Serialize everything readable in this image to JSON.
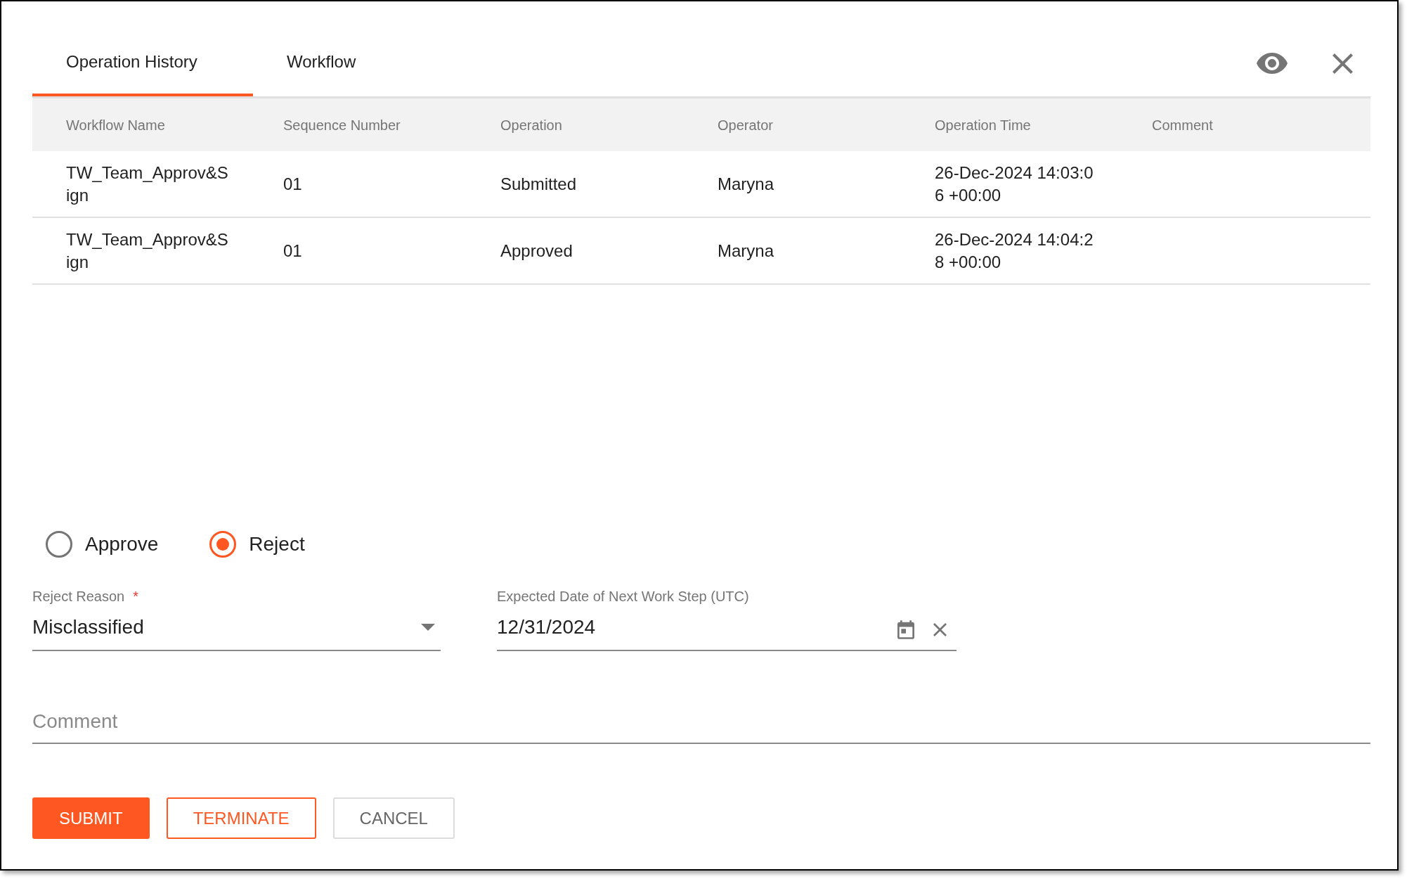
{
  "tabs": [
    {
      "label": "Operation History",
      "selected": true
    },
    {
      "label": "Workflow",
      "selected": false
    }
  ],
  "table": {
    "columns": [
      "Workflow Name",
      "Sequence Number",
      "Operation",
      "Operator",
      "Operation Time",
      "Comment"
    ],
    "rows": [
      {
        "cells": [
          "TW_Team_Approv&Sign",
          "01",
          "Submitted",
          "Maryna",
          "26-Dec-2024 14:03:06 +00:00"
        ]
      },
      {
        "cells": [
          "TW_Team_Approv&Sign",
          "01",
          "Approved",
          "Maryna",
          "26-Dec-2024 14:04:28 +00:00"
        ]
      }
    ]
  },
  "decision": {
    "options": [
      {
        "label": "Approve",
        "selected": false
      },
      {
        "label": "Reject",
        "selected": true
      }
    ]
  },
  "reject_reason": {
    "label": "Reject Reason",
    "required_mark": "*",
    "value": "Misclassified"
  },
  "expected_date": {
    "label": "Expected Date of Next Work Step (UTC)",
    "value": "12/31/2024"
  },
  "comment": {
    "placeholder": "Comment"
  },
  "buttons": [
    {
      "label": "SUBMIT",
      "kind": "primary"
    },
    {
      "label": "TERMINATE",
      "kind": "outline"
    },
    {
      "label": "CANCEL",
      "kind": "plain"
    }
  ]
}
